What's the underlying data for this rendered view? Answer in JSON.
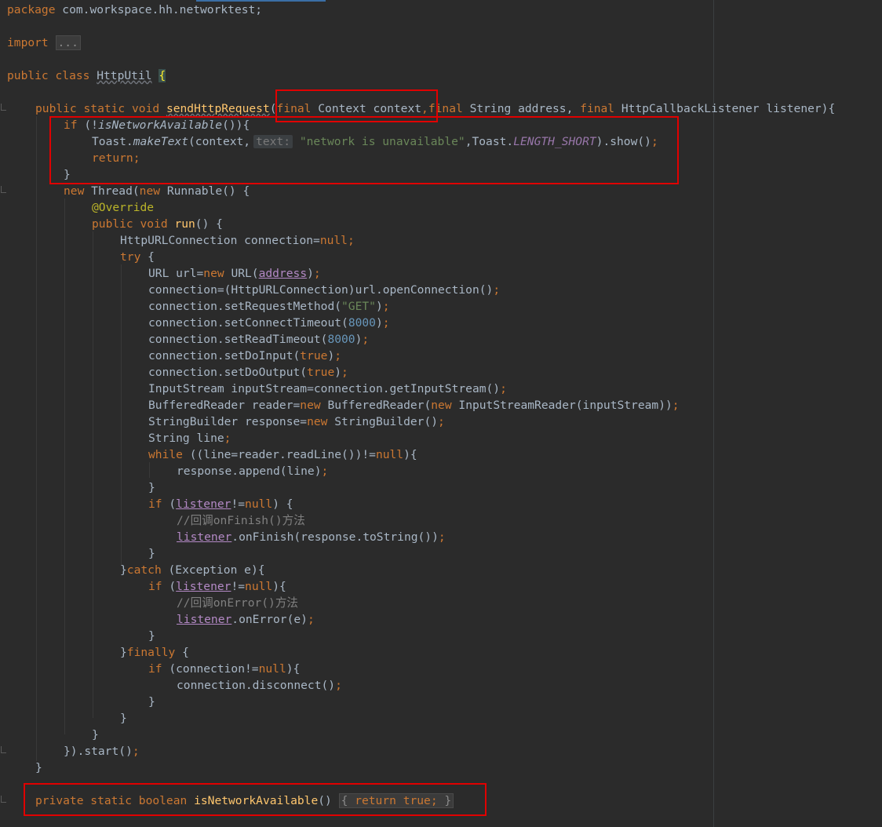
{
  "editor": {
    "language": "java",
    "file_class": "HttpUtil",
    "accent_color": "#3a6ea5",
    "highlight_box_color": "#e00000",
    "lines": {
      "l1": {
        "a": "package ",
        "b": "com.workspace.hh.networktest;"
      },
      "l2": {
        "a": "import ",
        "b": "..."
      },
      "l3": {
        "a": "public class ",
        "b": "HttpUtil",
        "c": " ",
        "d": "{"
      },
      "l4": {
        "a": "public static void ",
        "b": "sendHttpRequest",
        "c": "(",
        "d": "final ",
        "e": "Context context",
        "f": ",",
        "g": "final ",
        "h": "String address, ",
        "i": "final ",
        "j": "HttpCallbackListener listener){"
      },
      "l5": {
        "a": "if ",
        "b": "(!",
        "c": "isNetworkAvailable",
        "d": "()){"
      },
      "l6": {
        "a": "Toast.",
        "b": "makeText",
        "c": "(context,",
        "d": "text:",
        "e": "\"network is unavailable\"",
        "f": ",Toast.",
        "g": "LENGTH_SHORT",
        "h": ").show()",
        "i": ";"
      },
      "l7": {
        "a": "return;"
      },
      "l8": {
        "a": "}"
      },
      "l9": {
        "a": "new ",
        "b": "Thread(",
        "c": "new ",
        "d": "Runnable() {"
      },
      "l10": {
        "a": "@Override"
      },
      "l11": {
        "a": "public void ",
        "b": "run",
        "c": "() {"
      },
      "l12": {
        "a": "HttpURLConnection connection=",
        "b": "null",
        "c": ";"
      },
      "l13": {
        "a": "try ",
        "b": "{"
      },
      "l14": {
        "a": "URL url=",
        "b": "new ",
        "c": "URL(",
        "d": "address",
        "e": ")",
        "f": ";"
      },
      "l15": {
        "a": "connection=(HttpURLConnection)url.openConnection()",
        "b": ";"
      },
      "l16": {
        "a": "connection.setRequestMethod(",
        "b": "\"GET\"",
        "c": ")",
        "d": ";"
      },
      "l17": {
        "a": "connection.setConnectTimeout(",
        "b": "8000",
        "c": ")",
        "d": ";"
      },
      "l18": {
        "a": "connection.setReadTimeout(",
        "b": "8000",
        "c": ")",
        "d": ";"
      },
      "l19": {
        "a": "connection.setDoInput(",
        "b": "true",
        "c": ")",
        "d": ";"
      },
      "l20": {
        "a": "connection.setDoOutput(",
        "b": "true",
        "c": ")",
        "d": ";"
      },
      "l21": {
        "a": "InputStream inputStream=connection.getInputStream()",
        "b": ";"
      },
      "l22": {
        "a": "BufferedReader reader=",
        "b": "new ",
        "c": "BufferedReader(",
        "d": "new ",
        "e": "InputStreamReader(inputStream))",
        "f": ";"
      },
      "l23": {
        "a": "StringBuilder response=",
        "b": "new ",
        "c": "StringBuilder()",
        "d": ";"
      },
      "l24": {
        "a": "String line",
        "b": ";"
      },
      "l25": {
        "a": "while ",
        "b": "((line=reader.readLine())!=",
        "c": "null",
        "d": "){"
      },
      "l26": {
        "a": "response.append(line)",
        "b": ";"
      },
      "l27": {
        "a": "}"
      },
      "l28": {
        "a": "if ",
        "b": "(",
        "c": "listener",
        "d": "!=",
        "e": "null",
        "f": ") {"
      },
      "l29": {
        "a": "//回调onFinish()方法"
      },
      "l30": {
        "a": "listener",
        "b": ".onFinish(response.toString())",
        "c": ";"
      },
      "l31": {
        "a": "}"
      },
      "l32": {
        "a": "}",
        "b": "catch ",
        "c": "(Exception e){"
      },
      "l33": {
        "a": "if ",
        "b": "(",
        "c": "listener",
        "d": "!=",
        "e": "null",
        "f": "){"
      },
      "l34": {
        "a": "//回调onError()方法"
      },
      "l35": {
        "a": "listener",
        "b": ".onError(e)",
        "c": ";"
      },
      "l36": {
        "a": "}"
      },
      "l37": {
        "a": "}",
        "b": "finally ",
        "c": "{"
      },
      "l38": {
        "a": "if ",
        "b": "(connection!=",
        "c": "null",
        "d": "){"
      },
      "l39": {
        "a": "connection.disconnect()",
        "b": ";"
      },
      "l40": {
        "a": "}"
      },
      "l41": {
        "a": "}"
      },
      "l42": {
        "a": "}"
      },
      "l43": {
        "a": "}).start()",
        "b": ";"
      },
      "l44": {
        "a": "}"
      },
      "l45": {
        "a": "private static boolean ",
        "b": "isNetworkAvailable",
        "c": "() ",
        "d": "{",
        "e": " return true;",
        "f": " }"
      }
    }
  }
}
